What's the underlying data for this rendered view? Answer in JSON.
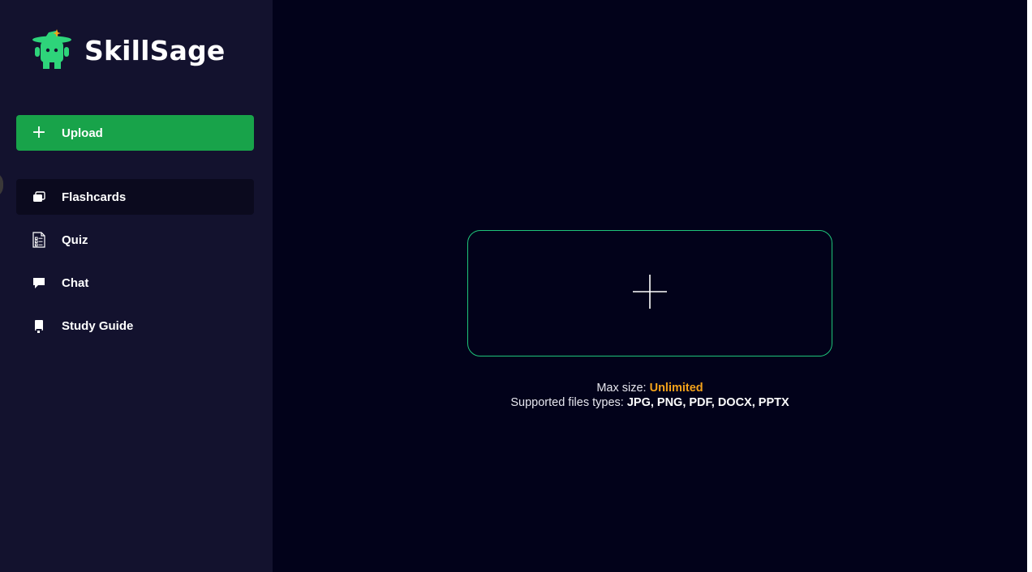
{
  "brand": {
    "name": "SkillSage"
  },
  "upload_button": {
    "label": "Upload",
    "icon": "plus-icon"
  },
  "nav": [
    {
      "label": "Flashcards",
      "icon": "flashcards-icon",
      "active": true
    },
    {
      "label": "Quiz",
      "icon": "quiz-icon",
      "active": false
    },
    {
      "label": "Chat",
      "icon": "chat-icon",
      "active": false
    },
    {
      "label": "Study Guide",
      "icon": "study-guide-icon",
      "active": false
    }
  ],
  "dropzone": {
    "icon": "plus-icon"
  },
  "info": {
    "max_size_label": "Max size: ",
    "max_size_value": "Unlimited",
    "types_label": "Supported files types: ",
    "types_value": "JPG, PNG, PDF, DOCX, PPTX"
  },
  "colors": {
    "sidebar_bg": "#13122e",
    "main_bg": "#02021a",
    "accent_green": "#18a34a",
    "dropzone_border": "#1ec47a",
    "highlight_orange": "#f4a21a"
  }
}
